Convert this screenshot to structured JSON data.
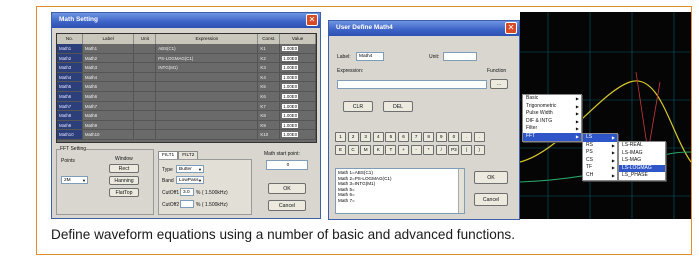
{
  "caption": "Define waveform equations using a number of basic and advanced functions.",
  "colors": {
    "frame": "#e08f2d",
    "titlebar": "#3c62c6",
    "selection": "#2f56c9",
    "scope_grid": "#0b5c6b"
  },
  "math_setting": {
    "title": "Math Setting",
    "close_icon": "close-x",
    "columns": [
      "No.",
      "Label",
      "Unit",
      "Expression",
      "Const.",
      "Value"
    ],
    "rows": [
      {
        "no": "Math1",
        "label": "Math1",
        "unit": "",
        "expr": "ABS(C1)",
        "const": "K1",
        "value": "1.00E0"
      },
      {
        "no": "Math2",
        "label": "Math2",
        "unit": "",
        "expr": "PS-LOGMAG(C1)",
        "const": "K2",
        "value": "1.00E0"
      },
      {
        "no": "Math3",
        "label": "Math3",
        "unit": "",
        "expr": "INTG(M1)",
        "const": "K3",
        "value": "1.00E0"
      },
      {
        "no": "Math4",
        "label": "Math4",
        "unit": "",
        "expr": "",
        "const": "K4",
        "value": "1.00E0"
      },
      {
        "no": "Math5",
        "label": "Math5",
        "unit": "",
        "expr": "",
        "const": "K5",
        "value": "1.00E0"
      },
      {
        "no": "Math6",
        "label": "Math6",
        "unit": "",
        "expr": "",
        "const": "K6",
        "value": "1.00E0"
      },
      {
        "no": "Math7",
        "label": "Math7",
        "unit": "",
        "expr": "",
        "const": "K7",
        "value": "1.00E0"
      },
      {
        "no": "Math8",
        "label": "Math8",
        "unit": "",
        "expr": "",
        "const": "K8",
        "value": "1.00E0"
      },
      {
        "no": "Math9",
        "label": "Math9",
        "unit": "",
        "expr": "",
        "const": "K9",
        "value": "1.00E0"
      },
      {
        "no": "Math10",
        "label": "Math10",
        "unit": "",
        "expr": "",
        "const": "K10",
        "value": "1.00E0"
      }
    ],
    "fft": {
      "group": "FFT Setting",
      "points_label": "Points",
      "points_value": "2M",
      "window_label": "Window",
      "windows": [
        "Rect",
        "Hanning",
        "FlatTop"
      ]
    },
    "filter_tabs": [
      "FILT1",
      "FILT2"
    ],
    "filter": {
      "type_label": "Type",
      "type_value": "Butter",
      "band_label": "Band",
      "band_value": "LowPass",
      "cutoff1_label": "CutOff1",
      "cutoff1_value": "3.0",
      "cutoff1_suffix": "% ( 1.500kHz)",
      "cutoff2_label": "CutOff2",
      "cutoff2_value": "",
      "cutoff2_suffix": "% ( 1.500kHz)"
    },
    "math_start": {
      "label": "Math start point:",
      "value": "0"
    },
    "ok": "OK",
    "cancel": "Cancel"
  },
  "user_define": {
    "title": "User Define Math4",
    "label_caption": "Label:",
    "label_value": "Math4",
    "unit_caption": "Unit:",
    "unit_value": "",
    "expression_caption": "Expression:",
    "function_caption": "Function",
    "function_button": "...",
    "clr": "CLR",
    "del": "DEL",
    "keys_row1": [
      "1",
      "2",
      "3",
      "4",
      "5",
      "6",
      "7",
      "8",
      "9",
      "0",
      ".",
      "."
    ],
    "keys_row2": [
      "E",
      "C",
      "M",
      "K",
      "T",
      "+",
      "-",
      "*",
      "/",
      "P3",
      "(",
      ")"
    ],
    "defined": [
      "Math 1=ABS(C1)",
      "Math 2=PS-LOGMAG(C1)",
      "Math 3=INTG(M1)",
      "Math 5=",
      "Math 6=",
      "Math 7="
    ],
    "ok": "OK",
    "cancel": "Cancel"
  },
  "function_menu": {
    "items": [
      "Basic",
      "Trigonometric",
      "Pulse Width",
      "DIF & INTG",
      "Filter",
      "FFT"
    ],
    "selected": "FFT"
  },
  "fft_menu": {
    "items": [
      "LS",
      "RS",
      "PS",
      "CS",
      "TF",
      "CH"
    ],
    "selected": "LS"
  },
  "ls_menu": {
    "items": [
      "LS-REAL",
      "LS-IMAG",
      "LS-MAG",
      "LS-LOGMAG",
      "LS_PHASE"
    ],
    "selected": "LS-LOGMAG"
  }
}
